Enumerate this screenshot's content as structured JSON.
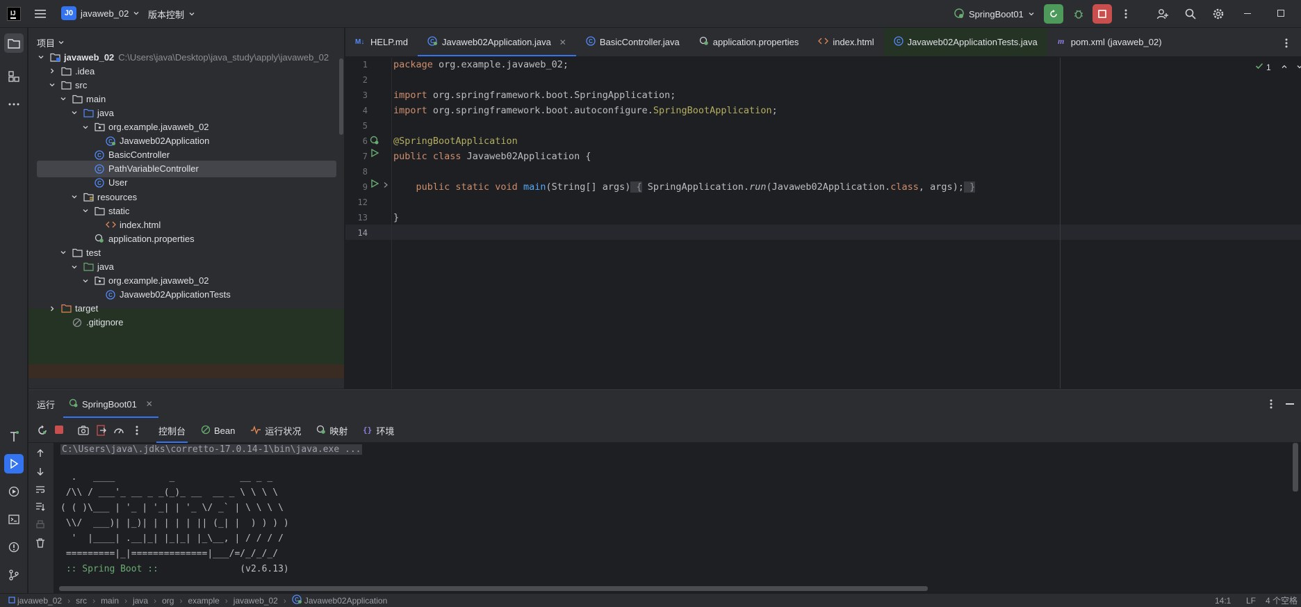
{
  "titlebar": {
    "project_badge": "J0",
    "project_name": "javaweb_02",
    "vcs_label": "版本控制",
    "run_config": "SpringBoot01"
  },
  "project_panel": {
    "title": "项目",
    "tree": [
      {
        "label": "javaweb_02",
        "path": "C:\\Users\\java\\Desktop\\java_study\\apply\\javaweb_02",
        "icon": "module-folder-icon",
        "expanded": true
      },
      {
        "label": ".idea",
        "icon": "folder-icon"
      },
      {
        "label": "src",
        "icon": "folder-icon"
      },
      {
        "label": "main",
        "icon": "folder-icon"
      },
      {
        "label": "java",
        "icon": "source-folder-icon"
      },
      {
        "label": "org.example.javaweb_02",
        "icon": "package-icon"
      },
      {
        "label": "Javaweb02Application",
        "icon": "spring-class-icon"
      },
      {
        "label": "BasicController",
        "icon": "class-icon"
      },
      {
        "label": "PathVariableController",
        "icon": "class-icon"
      },
      {
        "label": "User",
        "icon": "class-icon"
      },
      {
        "label": "resources",
        "icon": "resources-folder-icon"
      },
      {
        "label": "static",
        "icon": "folder-icon"
      },
      {
        "label": "index.html",
        "icon": "html-file-icon"
      },
      {
        "label": "application.properties",
        "icon": "properties-file-icon"
      },
      {
        "label": "test",
        "icon": "folder-icon"
      },
      {
        "label": "java",
        "icon": "test-source-folder-icon"
      },
      {
        "label": "org.example.javaweb_02",
        "icon": "package-icon"
      },
      {
        "label": "Javaweb02ApplicationTests",
        "icon": "class-icon"
      },
      {
        "label": "target",
        "icon": "excluded-folder-icon"
      },
      {
        "label": ".gitignore",
        "icon": "ignore-file-icon"
      }
    ]
  },
  "editor": {
    "tabs": [
      {
        "label": "HELP.md",
        "icon": "markdown-icon"
      },
      {
        "label": "Javaweb02Application.java",
        "icon": "spring-class-icon",
        "active": true
      },
      {
        "label": "BasicController.java",
        "icon": "class-icon"
      },
      {
        "label": "application.properties",
        "icon": "properties-file-icon"
      },
      {
        "label": "index.html",
        "icon": "html-file-icon"
      },
      {
        "label": "Javaweb02ApplicationTests.java",
        "icon": "class-icon"
      },
      {
        "label": "pom.xml (javaweb_02)",
        "icon": "maven-icon"
      }
    ],
    "inspection_count": "1",
    "line_numbers": [
      "1",
      "2",
      "3",
      "4",
      "5",
      "6",
      "7",
      "8",
      "9",
      "12",
      "13",
      "14"
    ],
    "code": {
      "l1_kw": "package",
      "l1_rest": " org.example.javaweb_02;",
      "l3_kw": "import",
      "l3_rest": " org.springframework.boot.SpringApplication;",
      "l4_kw": "import",
      "l4_rest": " org.springframework.boot.autoconfigure.",
      "l4_ann": "SpringBootApplication",
      "l4_end": ";",
      "l6_ann": "@SpringBootApplication",
      "l7_kw": "public class",
      "l7_rest": " Javaweb02Application {",
      "l9_kw": "    public static void",
      "l9_fn": " main",
      "l9_rest": "(String[] args)",
      "l9_brace_open": " {",
      "l9_body": " SpringApplication.",
      "l9_run": "run",
      "l9_args": "(Javaweb02Application.",
      "l9_class": "class",
      "l9_args2": ", args);",
      "l9_brace_close": " }",
      "l13": "}"
    }
  },
  "run_panel": {
    "title": "运行",
    "tab_label": "SpringBoot01",
    "toolbar_tabs": [
      {
        "label": "控制台",
        "icon": "",
        "active": true
      },
      {
        "label": "Bean",
        "icon": "bean-icon"
      },
      {
        "label": "运行状况",
        "icon": "health-icon"
      },
      {
        "label": "映射",
        "icon": "mapping-icon"
      },
      {
        "label": "环境",
        "icon": "env-icon"
      }
    ],
    "console": {
      "command": "C:\\Users\\java\\.jdks\\corretto-17.0.14-1\\bin\\java.exe ...",
      "banner": [
        "  .   ____          _            __ _ _",
        " /\\\\ / ___'_ __ _ _(_)_ __  __ _ \\ \\ \\ \\",
        "( ( )\\___ | '_ | '_| | '_ \\/ _` | \\ \\ \\ \\",
        " \\\\/  ___)| |_)| | | | | || (_| |  ) ) ) )",
        "  '  |____| .__|_| |_|_| |_\\__, | / / / /",
        " =========|_|==============|___/=/_/_/_/"
      ],
      "spring_boot_label": " :: Spring Boot :: ",
      "spring_boot_version": "              (v2.6.13)"
    }
  },
  "statusbar": {
    "breadcrumbs": [
      "javaweb_02",
      "src",
      "main",
      "java",
      "org",
      "example",
      "javaweb_02",
      "Javaweb02Application"
    ],
    "cursor": "14:1",
    "line_ending": "LF",
    "indent": "4 个空格"
  },
  "colors": {
    "accent": "#3574f0",
    "run_green": "#4e9a5b",
    "stop_red": "#c94f4f"
  }
}
